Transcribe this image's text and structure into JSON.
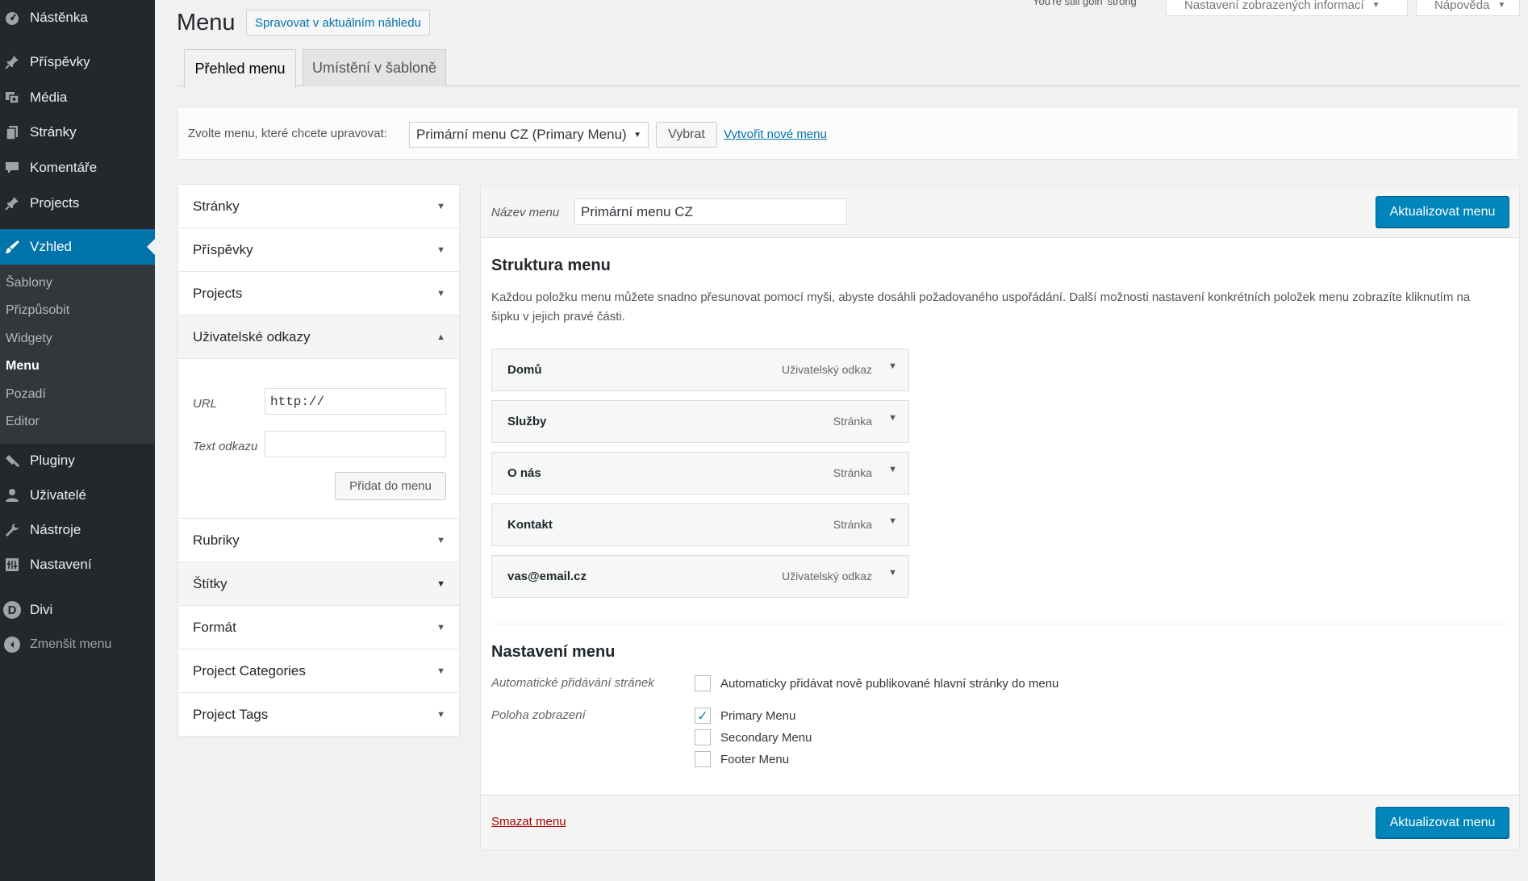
{
  "sidebar": {
    "items": [
      {
        "label": "Nástěnka",
        "icon": "dashboard-icon"
      },
      {
        "label": "Příspěvky",
        "icon": "pin-icon"
      },
      {
        "label": "Média",
        "icon": "media-icon"
      },
      {
        "label": "Stránky",
        "icon": "pages-icon"
      },
      {
        "label": "Komentáře",
        "icon": "comment-icon"
      },
      {
        "label": "Projects",
        "icon": "pin-icon"
      },
      {
        "label": "Vzhled",
        "icon": "brush-icon"
      },
      {
        "label": "Pluginy",
        "icon": "plugin-icon"
      },
      {
        "label": "Uživatelé",
        "icon": "users-icon"
      },
      {
        "label": "Nástroje",
        "icon": "wrench-icon"
      },
      {
        "label": "Nastavení",
        "icon": "settings-icon"
      },
      {
        "label": "Divi",
        "icon": "divi-icon"
      }
    ],
    "submenu": [
      "Šablony",
      "Přizpůsobit",
      "Widgety",
      "Menu",
      "Pozadí",
      "Editor"
    ],
    "collapse_label": "Zmenšit menu"
  },
  "top": {
    "note": "You're still goin' strong",
    "screen_options": "Nastavení zobrazených informací",
    "help": "Nápověda"
  },
  "page": {
    "title": "Menu",
    "manage_live": "Spravovat v aktuálním náhledu"
  },
  "tabs": [
    "Přehled menu",
    "Umístění v šabloně"
  ],
  "select_bar": {
    "label": "Zvolte menu, které chcete upravovat:",
    "selected": "Primární menu CZ (Primary Menu)",
    "select_button": "Vybrat",
    "create_link": "Vytvořit nové menu"
  },
  "accordion": {
    "sections": [
      "Stránky",
      "Příspěvky",
      "Projects",
      "Uživatelské odkazy",
      "Rubriky",
      "Štítky",
      "Formát",
      "Project Categories",
      "Project Tags"
    ],
    "custom_links": {
      "url_label": "URL",
      "url_value": "http://",
      "text_label": "Text odkazu",
      "text_value": "",
      "add_button": "Přidat do menu"
    }
  },
  "menu_editor": {
    "name_label": "Název menu",
    "name_value": "Primární menu CZ",
    "save_button": "Aktualizovat menu",
    "structure_title": "Struktura menu",
    "structure_desc": "Každou položku menu můžete snadno přesunovat pomocí myši, abyste dosáhli požadovaného uspořádání. Další možnosti nastavení konkrétních položek menu zobrazíte kliknutím na šipku v jejich pravé části.",
    "items": [
      {
        "title": "Domů",
        "type": "Uživatelský odkaz"
      },
      {
        "title": "Služby",
        "type": "Stránka"
      },
      {
        "title": "O nás",
        "type": "Stránka"
      },
      {
        "title": "Kontakt",
        "type": "Stránka"
      },
      {
        "title": "vas@email.cz",
        "type": "Uživatelský odkaz"
      }
    ],
    "settings_title": "Nastavení menu",
    "auto_add_label": "Automatické přidávání stránek",
    "auto_add_option": "Automaticky přidávat nově publikované hlavní stránky do menu",
    "auto_add_checked": false,
    "location_label": "Poloha zobrazení",
    "locations": [
      {
        "label": "Primary Menu",
        "checked": true
      },
      {
        "label": "Secondary Menu",
        "checked": false
      },
      {
        "label": "Footer Menu",
        "checked": false
      }
    ],
    "delete_link": "Smazat menu"
  },
  "colors": {
    "sidebar_bg": "#23282d",
    "accent": "#0073aa",
    "primary_button": "#0085ba",
    "delete": "#aa0000"
  }
}
